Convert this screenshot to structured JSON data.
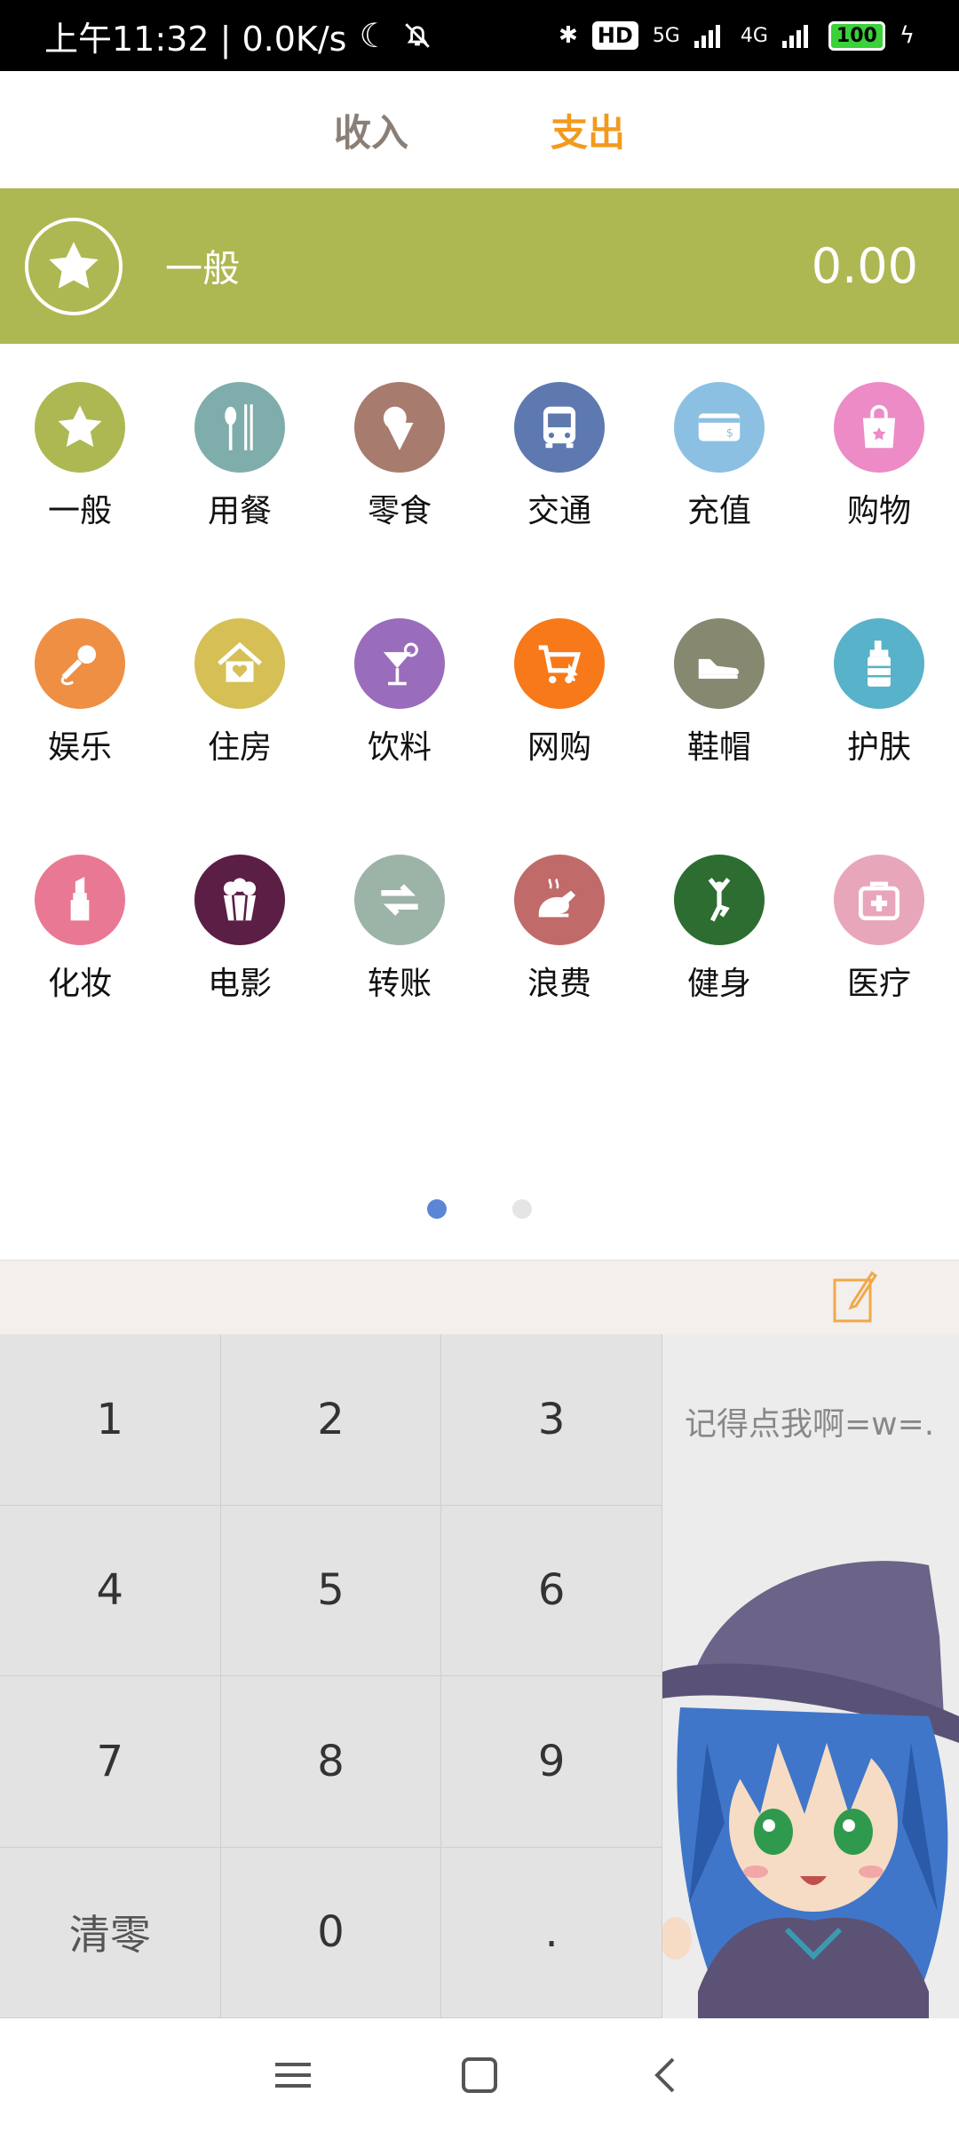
{
  "status_bar": {
    "time_speed": "上午11:32 | 0.0K/s",
    "hd_label": "HD",
    "network_5g": "5G",
    "network_4g": "4G",
    "battery": "100"
  },
  "tabs": {
    "income": "收入",
    "expense": "支出"
  },
  "selected": {
    "category": "一般",
    "amount": "0.00",
    "icon": "star-icon",
    "color": "#adb852"
  },
  "categories": [
    {
      "label": "一般",
      "icon": "star-icon",
      "color": "#adb852"
    },
    {
      "label": "用餐",
      "icon": "fork-knife-icon",
      "color": "#7fadab"
    },
    {
      "label": "零食",
      "icon": "ice-cream-icon",
      "color": "#a87b6f"
    },
    {
      "label": "交通",
      "icon": "bus-icon",
      "color": "#5d79b0"
    },
    {
      "label": "充值",
      "icon": "card-icon",
      "color": "#8cc0e3"
    },
    {
      "label": "购物",
      "icon": "shopping-bag-icon",
      "color": "#ec8bc6"
    },
    {
      "label": "娱乐",
      "icon": "microphone-icon",
      "color": "#ef8f44"
    },
    {
      "label": "住房",
      "icon": "house-icon",
      "color": "#d6bf55"
    },
    {
      "label": "饮料",
      "icon": "cocktail-icon",
      "color": "#9a6cbc"
    },
    {
      "label": "网购",
      "icon": "shopping-cart-icon",
      "color": "#f7791a"
    },
    {
      "label": "鞋帽",
      "icon": "shoe-icon",
      "color": "#86896f"
    },
    {
      "label": "护肤",
      "icon": "lotion-bottle-icon",
      "color": "#58b2c9"
    },
    {
      "label": "化妆",
      "icon": "lipstick-icon",
      "color": "#e97894"
    },
    {
      "label": "电影",
      "icon": "popcorn-icon",
      "color": "#5b1e44"
    },
    {
      "label": "转账",
      "icon": "transfer-arrows-icon",
      "color": "#9cb3a8"
    },
    {
      "label": "浪费",
      "icon": "roast-chicken-icon",
      "color": "#c16a6a"
    },
    {
      "label": "健身",
      "icon": "yoga-figure-icon",
      "color": "#2d6d31"
    },
    {
      "label": "医疗",
      "icon": "first-aid-kit-icon",
      "color": "#e8a6bb"
    }
  ],
  "pager": {
    "active_page": 1,
    "total_pages": 2
  },
  "keypad": {
    "keys": [
      "1",
      "2",
      "3",
      "4",
      "5",
      "6",
      "7",
      "8",
      "9",
      "清零",
      "0",
      "."
    ]
  },
  "side_panel": {
    "text": "记得点我啊=w=."
  },
  "navbar": {
    "menu_icon": "menu-icon",
    "home_icon": "home-square-icon",
    "back_icon": "back-chevron-icon"
  }
}
